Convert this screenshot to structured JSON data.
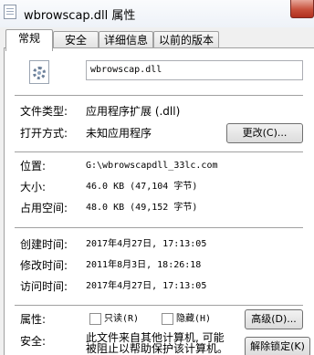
{
  "window": {
    "title": "wbrowscap.dll 属性"
  },
  "tabs": [
    "常规",
    "安全",
    "详细信息",
    "以前的版本"
  ],
  "file": {
    "name": "wbrowscap.dll"
  },
  "rows": {
    "type": {
      "label": "文件类型:",
      "value": "应用程序扩展 (.dll)"
    },
    "opens_with": {
      "label": "打开方式:",
      "value": "未知应用程序",
      "button": "更改(C)..."
    },
    "location": {
      "label": "位置:",
      "value": "G:\\wbrowscapdll_33lc.com"
    },
    "size": {
      "label": "大小:",
      "value": "46.0 KB (47,104 字节)"
    },
    "size_on_disk": {
      "label": "占用空间:",
      "value": "48.0 KB (49,152 字节)"
    },
    "created": {
      "label": "创建时间:",
      "value": "2017年4月27日, 17:13:05"
    },
    "modified": {
      "label": "修改时间:",
      "value": "2011年8月3日, 18:26:18"
    },
    "accessed": {
      "label": "访问时间:",
      "value": "2017年4月27日, 17:13:05"
    },
    "attributes": {
      "label": "属性:",
      "readonly": "只读(R)",
      "hidden": "隐藏(H)",
      "advanced": "高级(D)..."
    },
    "security": {
      "label": "安全:",
      "line1": "此文件来自其他计算机, 可能",
      "line2": "被阻止以帮助保护该计算机。",
      "unblock": "解除锁定(K)"
    }
  }
}
